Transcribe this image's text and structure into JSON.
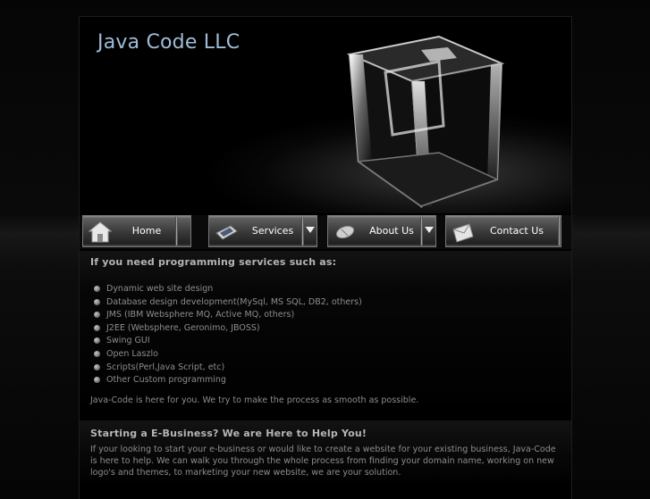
{
  "header": {
    "site_title": "Java Code LLC",
    "logo_image": "glass-cube-icon"
  },
  "nav": {
    "items": [
      {
        "label": "Home",
        "icon": "house-icon",
        "has_dropdown": false
      },
      {
        "label": "Services",
        "icon": "laptop-icon",
        "has_dropdown": true
      },
      {
        "label": "About Us",
        "icon": "mouse-icon",
        "has_dropdown": true
      },
      {
        "label": "Contact Us",
        "icon": "envelope-icon",
        "has_dropdown": false
      }
    ]
  },
  "services": {
    "heading": "If you need programming services such as:",
    "items": [
      "Dynamic web site design",
      "Database design development(MySql, MS SQL, DB2, others)",
      "JMS (IBM Websphere MQ, Active MQ, others)",
      "J2EE (Websphere, Geronimo, JBOSS)",
      "Swing GUI",
      "Open Laszlo",
      "Scripts(Perl,Java Script, etc)",
      "Other Custom programming"
    ],
    "closing": "Java-Code is here for you. We try to make the process as smooth as possible."
  },
  "ebusiness": {
    "heading": "Starting a E-Business? We are Here to Help You!",
    "body": "If your looking to start your e-business or would like to create a website for your existing business, Java-Code is here to help. We can walk you through the whole process from finding your domain name, working on new logo's and themes, to marketing your new website, we are your solution."
  }
}
